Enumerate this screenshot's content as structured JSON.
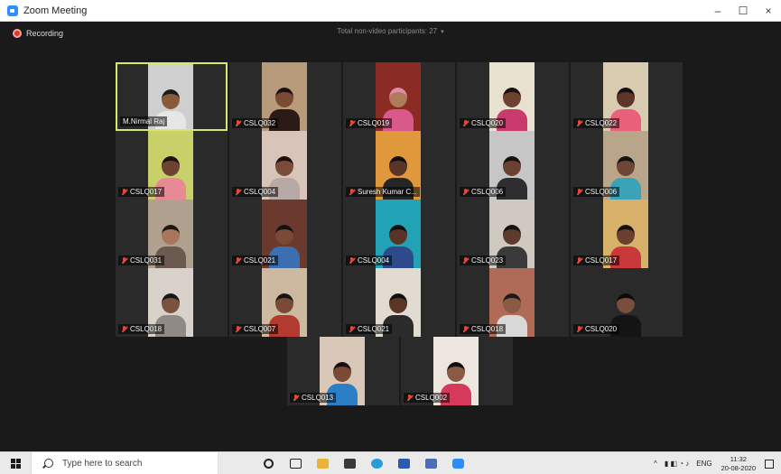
{
  "window": {
    "title": "Zoom Meeting",
    "minimize": "–",
    "maximize": "☐",
    "close": "×"
  },
  "meeting": {
    "recording_label": "Recording",
    "nonvideo_label": "Total non-video participants: 27",
    "caret": "▾"
  },
  "participants": [
    {
      "name": "M.Nirmal Raj",
      "muted": false,
      "active": true,
      "bg": "#cfcfcf",
      "skin": "#8a5a3c",
      "shirt": "#e6e6e6",
      "hair": "#1a1a1a"
    },
    {
      "name": "CSLQ032",
      "muted": true,
      "active": false,
      "bg": "#b79a7a",
      "skin": "#7b4a35",
      "shirt": "#2b1a16",
      "hair": "#1a1010"
    },
    {
      "name": "CSLQ019",
      "muted": true,
      "active": false,
      "bg": "#8a2b24",
      "skin": "#b07a5c",
      "shirt": "#d95a8a",
      "hair": "#e28bb0"
    },
    {
      "name": "CSLQ020",
      "muted": true,
      "active": false,
      "bg": "#e9e1cf",
      "skin": "#6e4230",
      "shirt": "#c93b6c",
      "hair": "#1b1111"
    },
    {
      "name": "CSLQ022",
      "muted": true,
      "active": false,
      "bg": "#d9cbb0",
      "skin": "#5c3628",
      "shirt": "#e8607a",
      "hair": "#141010"
    },
    {
      "name": "CSLQ017",
      "muted": true,
      "active": false,
      "bg": "#c9d06a",
      "skin": "#6e4232",
      "shirt": "#e88a94",
      "hair": "#1a1010"
    },
    {
      "name": "CSLQ004",
      "muted": true,
      "active": false,
      "bg": "#d8c4b8",
      "skin": "#7a4c3a",
      "shirt": "#b7a9a5",
      "hair": "#1a1010"
    },
    {
      "name": "Suresh Kumar C...",
      "muted": true,
      "active": false,
      "bg": "#e0983c",
      "skin": "#5a3527",
      "shirt": "#262626",
      "hair": "#101010"
    },
    {
      "name": "CSLQ006",
      "muted": true,
      "active": false,
      "bg": "#c6c6c6",
      "skin": "#6a4030",
      "shirt": "#2e2e2e",
      "hair": "#121212"
    },
    {
      "name": "CSLQ006",
      "muted": true,
      "active": false,
      "bg": "#b9a58a",
      "skin": "#6e4636",
      "shirt": "#3aa3b8",
      "hair": "#131313"
    },
    {
      "name": "CSLQ031",
      "muted": true,
      "active": false,
      "bg": "#b0a090",
      "skin": "#a8765c",
      "shirt": "#6b5a4f",
      "hair": "#1e1612"
    },
    {
      "name": "CSLQ021",
      "muted": true,
      "active": false,
      "bg": "#6b3a2f",
      "skin": "#7a4a36",
      "shirt": "#3c6fb0",
      "hair": "#121212"
    },
    {
      "name": "CSLQ004",
      "muted": true,
      "active": false,
      "bg": "#22a3b5",
      "skin": "#5a3324",
      "shirt": "#2f4a8a",
      "hair": "#0e0e0e"
    },
    {
      "name": "CSLQ023",
      "muted": true,
      "active": false,
      "bg": "#cfc9c1",
      "skin": "#5e3a2c",
      "shirt": "#3a3a3a",
      "hair": "#121212"
    },
    {
      "name": "CSLQ017",
      "muted": true,
      "active": false,
      "bg": "#d7b06a",
      "skin": "#6a3f2e",
      "shirt": "#c9383a",
      "hair": "#141010"
    },
    {
      "name": "CSLQ018",
      "muted": true,
      "active": false,
      "bg": "#d9d2ca",
      "skin": "#7a5240",
      "shirt": "#8f8a86",
      "hair": "#161616"
    },
    {
      "name": "CSLQ007",
      "muted": true,
      "active": false,
      "bg": "#cdb8a0",
      "skin": "#7a4a36",
      "shirt": "#b23a2e",
      "hair": "#141414"
    },
    {
      "name": "CSLQ021",
      "muted": true,
      "active": false,
      "bg": "#e2dbd2",
      "skin": "#5a3626",
      "shirt": "#2b2b2b",
      "hair": "#101010"
    },
    {
      "name": "CSLQ018",
      "muted": true,
      "active": false,
      "bg": "#b06a58",
      "skin": "#8a5a44",
      "shirt": "#d8d8d8",
      "hair": "#1a1a1a"
    },
    {
      "name": "CSLQ020",
      "muted": true,
      "active": false,
      "bg": "#2a2a2a",
      "skin": "#7a4e3c",
      "shirt": "#141414",
      "hair": "#0b0b0b"
    },
    {
      "name": "CSLQ013",
      "muted": true,
      "active": false,
      "bg": "#d9c7b7",
      "skin": "#7b4a36",
      "shirt": "#2d7fc5",
      "hair": "#181010"
    },
    {
      "name": "CSLQ002",
      "muted": true,
      "active": false,
      "bg": "#ece6df",
      "skin": "#8a5a44",
      "shirt": "#d63a5a",
      "hair": "#141010"
    }
  ],
  "taskbar": {
    "search_placeholder": "Type here to search",
    "apps": [
      "cortana",
      "task-view",
      "file-explorer",
      "mail",
      "edge",
      "word",
      "onenote",
      "zoom"
    ],
    "tray": {
      "caret": "^",
      "lang": "ENG",
      "time": "11:32",
      "date": "20-08-2020"
    }
  }
}
